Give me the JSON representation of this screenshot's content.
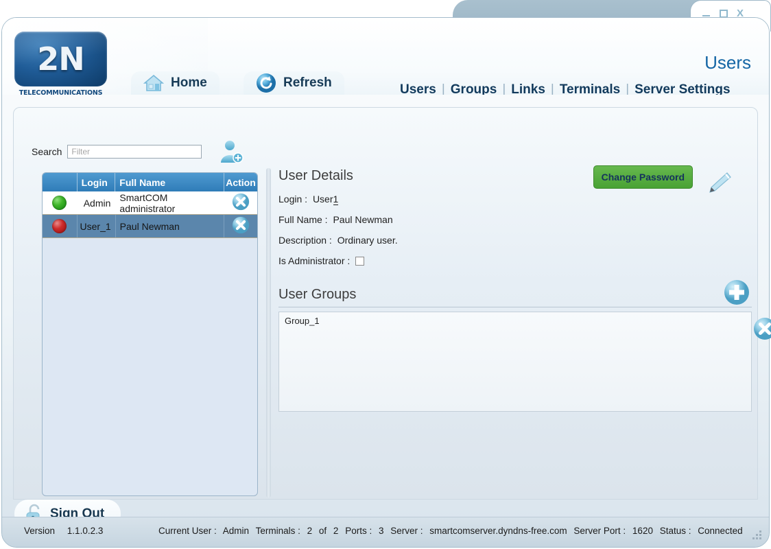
{
  "window": {
    "controls": [
      {
        "name": "minimize",
        "glyph": "–"
      },
      {
        "name": "maximize",
        "glyph": "□"
      },
      {
        "name": "close",
        "glyph": "X"
      }
    ]
  },
  "brand": {
    "logo_text": "2N",
    "tagline": "TELECOMMUNICATIONS"
  },
  "header": {
    "page_title": "Users",
    "buttons": [
      {
        "label": "Home",
        "icon": "home-icon"
      },
      {
        "label": "Refresh",
        "icon": "refresh-icon"
      }
    ],
    "nav": [
      {
        "label": "Users"
      },
      {
        "label": "Groups"
      },
      {
        "label": "Links"
      },
      {
        "label": "Terminals"
      },
      {
        "label": "Server Settings"
      }
    ],
    "nav_separator": "|"
  },
  "search": {
    "label": "Search",
    "value": "",
    "placeholder": "Filter",
    "add_icon": "add-user-icon"
  },
  "user_list": {
    "columns": [
      "",
      "Login",
      "Full Name",
      "Action"
    ],
    "rows": [
      {
        "status": "green",
        "login": "Admin",
        "full_name": "SmartCOM administrator",
        "action_icon": "delete-icon",
        "selected": false
      },
      {
        "status": "red",
        "login": "User_1",
        "full_name": "Paul Newman",
        "action_icon": "delete-icon",
        "selected": true
      }
    ]
  },
  "details": {
    "title": "User Details",
    "change_password_label": "Change Password",
    "edit_icon": "pencil-icon",
    "fields": [
      {
        "label": "Login :",
        "value": "User1"
      },
      {
        "label": "Full Name :",
        "value": "Paul Newman"
      },
      {
        "label": "Description :",
        "value": "Ordinary user."
      },
      {
        "label": "Is Administrator :",
        "value": ""
      }
    ],
    "is_administrator_checked": false
  },
  "user_groups": {
    "title": "User Groups",
    "add_icon": "plus-icon",
    "remove_icon": "delete-icon",
    "items": [
      {
        "name": "Group_1"
      }
    ]
  },
  "signout": {
    "label": "Sign Out",
    "icon": "unlock-icon"
  },
  "statusbar": {
    "version_label": "Version",
    "version_value": "1.1.0.2.3",
    "current_user_label": "Current User :",
    "current_user_value": "Admin",
    "terminals_label": "Terminals :",
    "terminals_value": "2",
    "terminals_of": "of",
    "terminals_total": "2",
    "ports_label": "Ports :",
    "ports_value": "3",
    "server_label": "Server :",
    "server_value": "smartcomserver.dyndns-free.com",
    "server_port_label": "Server Port :",
    "server_port_value": "1620",
    "status_label": "Status :",
    "status_value": "Connected"
  },
  "colors": {
    "accent": "#1566a5",
    "nav_text": "#123a5c",
    "green_button": "#49a234",
    "selected_row": "#5b86ac",
    "status_ok": "#3eb528",
    "status_off": "#ce2b2b"
  }
}
